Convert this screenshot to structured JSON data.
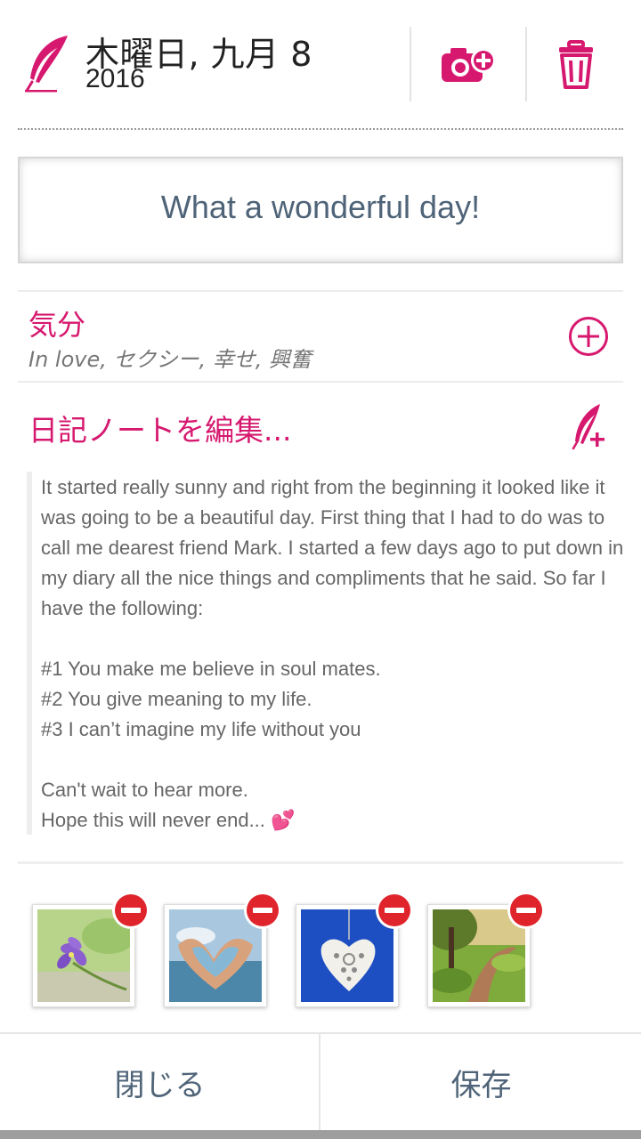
{
  "header": {
    "date": "木曜日, 九月 8",
    "year": "2016",
    "camera_icon": "add-photo-icon",
    "trash_icon": "trash-icon"
  },
  "entry": {
    "title": "What a wonderful day!"
  },
  "mood": {
    "label": "気分",
    "values": "In love, セクシー, 幸せ, 興奮"
  },
  "notes": {
    "edit_label": "日記ノートを編集...",
    "text": "It started really sunny and right from the beginning it looked like it was going to be a beautiful day. First thing that I had to do was to call me dearest friend Mark. I started a few days ago to put down in my diary all the nice things and compliments that he said. So far I have the following:\n\n#1 You make me believe in soul mates.\n#2 You give meaning to my life.\n#3 I can’t imagine my life without you\n\nCan't wait to hear more.\nHope this will never end... 💕"
  },
  "photos": [
    {
      "name": "photo-flower"
    },
    {
      "name": "photo-heart-hands"
    },
    {
      "name": "photo-heart-ornament"
    },
    {
      "name": "photo-path"
    }
  ],
  "footer": {
    "close_label": "閉じる",
    "save_label": "保存"
  },
  "colors": {
    "accent": "#d6196f",
    "text_blue": "#4f6478",
    "remove_red": "#e0242c"
  }
}
